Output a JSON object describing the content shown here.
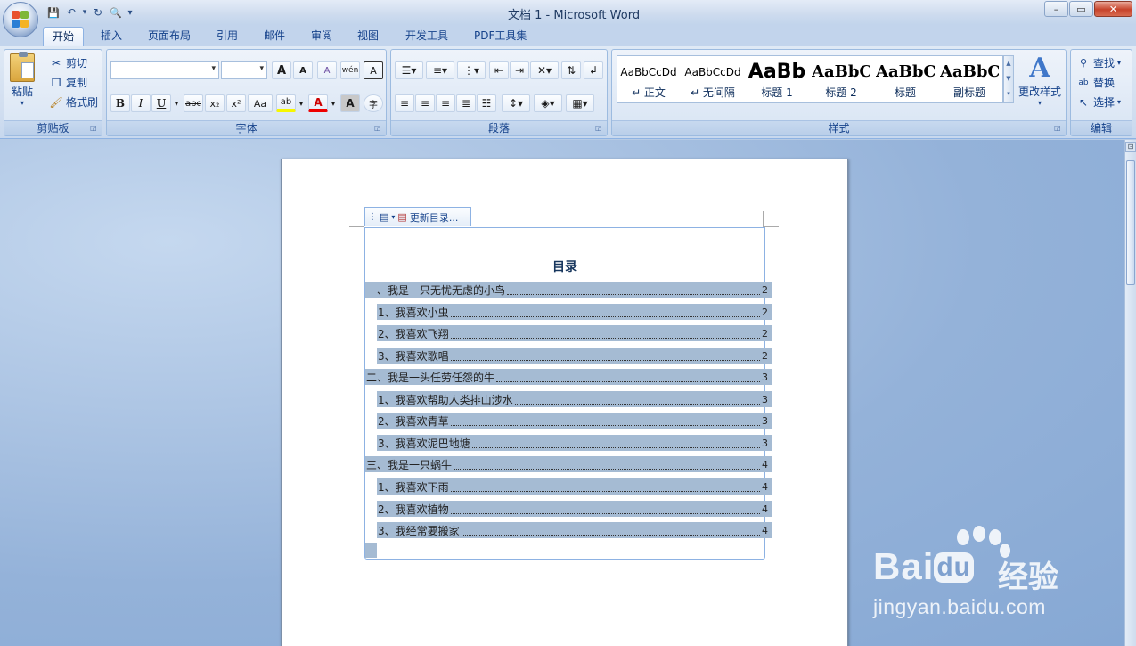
{
  "window": {
    "title": "文档 1 - Microsoft Word",
    "minimize": "–",
    "restore": "▭",
    "close": "✕"
  },
  "quick_access": {
    "save": "💾",
    "undo": "↶",
    "redo": "↻",
    "preview": "🔍",
    "more": "▾"
  },
  "tabs": [
    {
      "label": "开始",
      "active": true
    },
    {
      "label": "插入"
    },
    {
      "label": "页面布局"
    },
    {
      "label": "引用"
    },
    {
      "label": "邮件"
    },
    {
      "label": "审阅"
    },
    {
      "label": "视图"
    },
    {
      "label": "开发工具"
    },
    {
      "label": "PDF工具集"
    }
  ],
  "ribbon": {
    "clipboard": {
      "label": "剪贴板",
      "paste": "粘贴",
      "cut": "剪切",
      "copy": "复制",
      "format_painter": "格式刷"
    },
    "font": {
      "label": "字体",
      "font_name": "",
      "font_size": "",
      "grow": "A",
      "shrink": "A",
      "clear": "A",
      "phonetic": "wén",
      "border_char": "A",
      "bold": "B",
      "italic": "I",
      "underline": "U",
      "strike": "abc",
      "subscript": "x₂",
      "superscript": "x²",
      "change_case": "Aa",
      "highlight": "ab",
      "font_color": "A",
      "shading": "A",
      "enclose": "字"
    },
    "paragraph": {
      "label": "段落"
    },
    "styles": {
      "label": "样式",
      "items": [
        {
          "sample": "AaBbCcDd",
          "name": "↵ 正文"
        },
        {
          "sample": "AaBbCcDd",
          "name": "↵ 无间隔"
        },
        {
          "sample": "AaBb",
          "name": "标题 1"
        },
        {
          "sample": "AaBbC",
          "name": "标题 2"
        },
        {
          "sample": "AaBbC",
          "name": "标题"
        },
        {
          "sample": "AaBbC",
          "name": "副标题"
        }
      ],
      "change_styles": "更改样式"
    },
    "editing": {
      "label": "编辑",
      "find": "查找",
      "replace": "替换",
      "select": "选择"
    }
  },
  "toc": {
    "tab_label": "更新目录...",
    "title": "目录",
    "entries": [
      {
        "text": "一、我是一只无忧无虑的小鸟",
        "page": "2",
        "level": 1
      },
      {
        "text": "1、我喜欢小虫",
        "page": "2",
        "level": 2
      },
      {
        "text": "2、我喜欢飞翔",
        "page": "2",
        "level": 2
      },
      {
        "text": "3、我喜欢歌唱",
        "page": "2",
        "level": 2
      },
      {
        "text": "二、我是一头任劳任怨的牛",
        "page": "3",
        "level": 1
      },
      {
        "text": "1、我喜欢帮助人类排山涉水",
        "page": "3",
        "level": 2
      },
      {
        "text": "2、我喜欢青草",
        "page": "3",
        "level": 2
      },
      {
        "text": "3、我喜欢泥巴地塘",
        "page": "3",
        "level": 2
      },
      {
        "text": "三、我是一只蜗牛",
        "page": "4",
        "level": 1
      },
      {
        "text": "1、我喜欢下雨",
        "page": "4",
        "level": 2
      },
      {
        "text": "2、我喜欢植物",
        "page": "4",
        "level": 2
      },
      {
        "text": "3、我经常要搬家",
        "page": "4",
        "level": 2
      }
    ]
  },
  "watermark": {
    "brand": "Bai",
    "brand_du": "du",
    "brand_cn": "经验",
    "url": "jingyan.baidu.com"
  },
  "colors": {
    "selection": "#a5bbd3",
    "ribbon_text": "#15428b",
    "close_button": "#c7432b"
  }
}
